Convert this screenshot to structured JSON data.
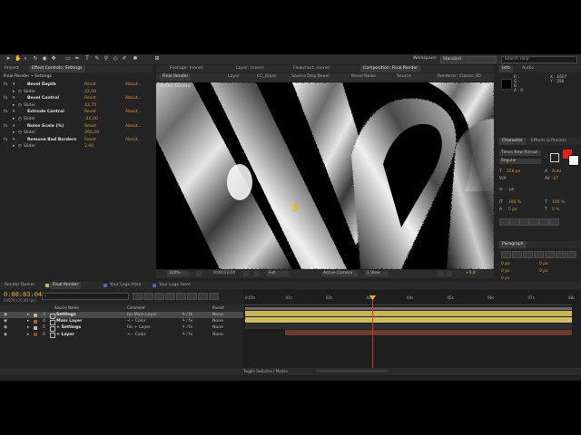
{
  "toolbar": {
    "workspace_label": "Workspace:",
    "workspace_value": "Standard",
    "search_placeholder": "Search Help"
  },
  "left_panel": {
    "tab_project": "Project",
    "tab_effect_controls": "Effect Controls: Settings",
    "breadcrumb": "Final Render • Settings",
    "effects": [
      {
        "name": "Bevel Depth",
        "reset": "Reset",
        "about": "About...",
        "param": "Slider",
        "value": "22,00"
      },
      {
        "name": "Bevel Control",
        "reset": "Reset",
        "about": "About...",
        "param": "Slider",
        "value": "43,70"
      },
      {
        "name": "Extrude Control",
        "reset": "Reset",
        "about": "About...",
        "param": "Slider",
        "value": "-26,00"
      },
      {
        "name": "Noise Scale (%)",
        "reset": "Reset",
        "about": "About...",
        "param": "Slider",
        "value": "290,00"
      },
      {
        "name": "Remove Bad Borders",
        "reset": "Reset",
        "about": "About...",
        "param": "Slider",
        "value": "2,00"
      }
    ]
  },
  "viewer": {
    "tabs": [
      "Footage: (none)",
      "Layer: (none)",
      "Flowchart: (none)",
      "Composition: Final Render"
    ],
    "subtabs": [
      "Final Render",
      "Layer",
      "CC_Glass",
      "Source Disp Bevel",
      "Bevel Noise",
      "Source",
      "Renderer: Classic 3D"
    ],
    "view_label": "Active Camera",
    "zoom": "100%",
    "timecode": "0;00;03;04",
    "resolution": "Full",
    "camera": "Active Camera",
    "view_count": "1 View",
    "exposure": "+0,0"
  },
  "right_panel": {
    "info_tab": "Info",
    "audio_tab": "Audio",
    "info_r": "R :",
    "info_g": "G :",
    "info_b": "B :",
    "info_a": "A : 0",
    "info_x": "X : 1607",
    "info_y": "Y : 356",
    "character_tab": "Character",
    "effects_tab": "Effects & Presets",
    "font": "Times New Roman",
    "style": "Regular",
    "font_size": "258 px",
    "leading": "Auto",
    "tracking": "-27",
    "size_unit": "- px",
    "vscale": "100 %",
    "hscale": "100 %",
    "baseline": "0 px",
    "tsume": "0 %",
    "paragraph_tab": "Paragraph",
    "indent_left": "0 px",
    "indent_right": "0 px",
    "indent_first": "0 px",
    "space_before": "0 px",
    "space_after": "0 px",
    "accent_color": "#e8201a"
  },
  "timeline": {
    "tab_render_queue": "Render Queue",
    "tab_final": "Final Render",
    "tab_your_logo": "Your Logo Here",
    "tab_your_logo2": "Your Logo Here",
    "current_time": "0:00:03:04",
    "frame_info": "00079 (25,00 fps)",
    "search_placeholder": "",
    "col_source": "Source Name",
    "col_comment": "Comment",
    "col_parent": "Parent",
    "layers": [
      {
        "num": "3",
        "name": "Settings",
        "comment": "for Main Layer",
        "parent": "None",
        "color": "#c8b45a",
        "selected": true
      },
      {
        "num": "4",
        "name": "Main Layer",
        "comment": "<-- Color",
        "parent": "None",
        "color": "#8a6a4a",
        "selected": false
      },
      {
        "num": "5",
        "name": "+ Settings",
        "comment": "for + Layer",
        "parent": "None",
        "color": "#b8b8b8",
        "selected": false
      },
      {
        "num": "6",
        "name": "+ Layer",
        "comment": "<-- Color",
        "parent": "None",
        "color": "#8a4a3a",
        "selected": false
      }
    ],
    "ruler_labels": [
      "0:00s",
      "01s",
      "02s",
      "03s",
      "04s",
      "05s",
      "06s",
      "07s",
      "08s"
    ],
    "toggle_label": "Toggle Switches / Modes"
  }
}
